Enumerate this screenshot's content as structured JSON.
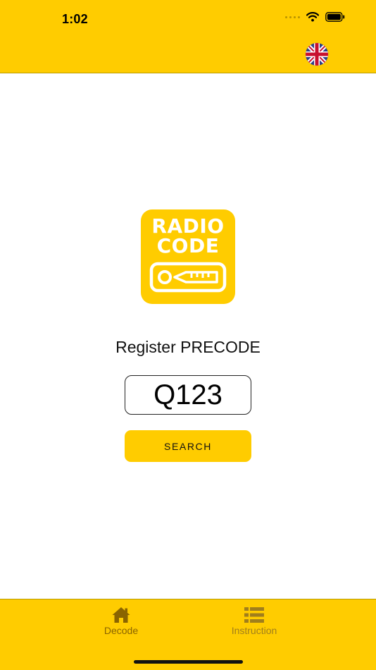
{
  "status_bar": {
    "time": "1:02"
  },
  "header": {
    "language_flag": "uk-flag-icon"
  },
  "logo": {
    "line1": "RADIO",
    "line2": "CODE"
  },
  "form": {
    "label": "Register PRECODE",
    "code_value": "Q123",
    "search_label": "SEARCH"
  },
  "tabs": [
    {
      "label": "Decode",
      "icon": "home-icon",
      "active": true
    },
    {
      "label": "Instruction",
      "icon": "list-icon",
      "active": false
    }
  ],
  "colors": {
    "accent": "#FFCC00",
    "active_tab": "#8a6400",
    "inactive_tab": "#a07e1c"
  }
}
